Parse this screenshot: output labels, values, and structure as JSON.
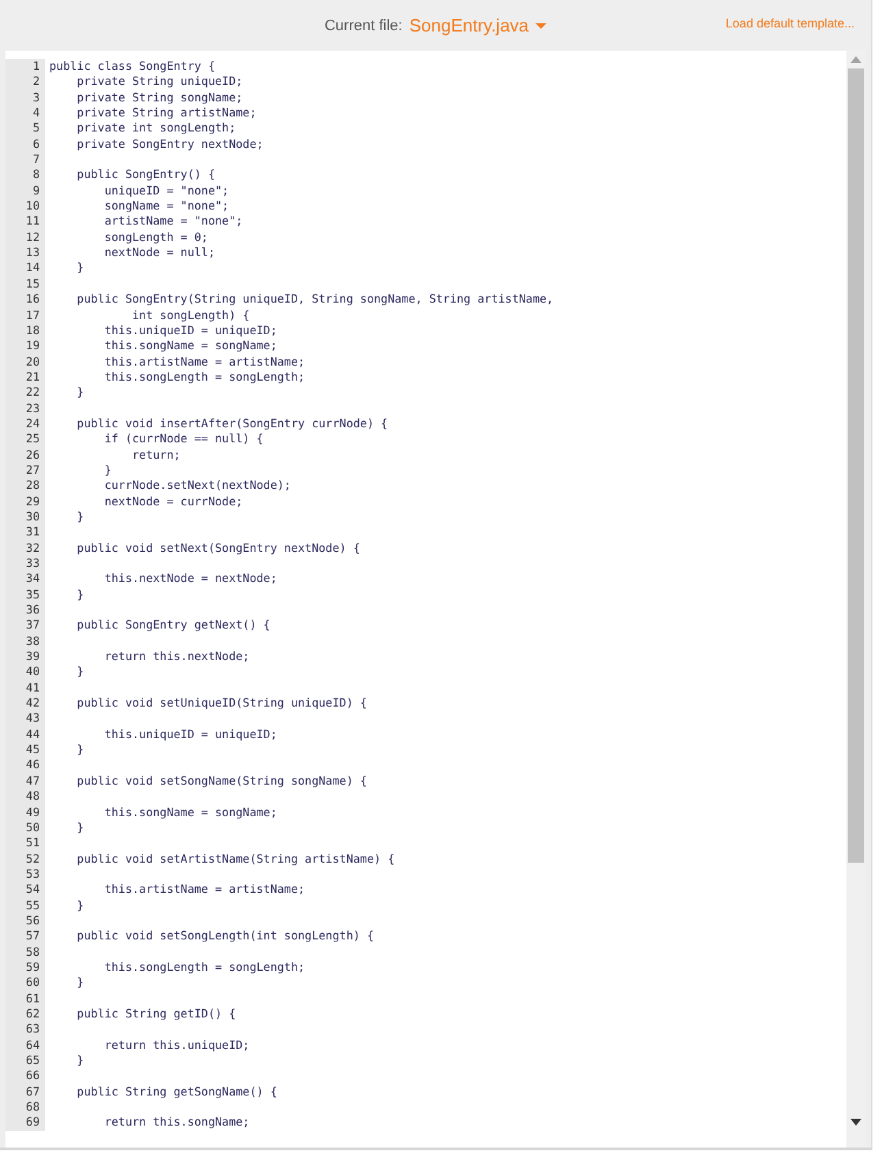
{
  "header": {
    "label": "Current file:",
    "file": "SongEntry.java",
    "action": "Load default template..."
  },
  "editor": {
    "lines": [
      {
        "n": "1",
        "code": "public class SongEntry {"
      },
      {
        "n": "2",
        "code": "    private String uniqueID;"
      },
      {
        "n": "3",
        "code": "    private String songName;"
      },
      {
        "n": "4",
        "code": "    private String artistName;"
      },
      {
        "n": "5",
        "code": "    private int songLength;"
      },
      {
        "n": "6",
        "code": "    private SongEntry nextNode;"
      },
      {
        "n": "7"
      },
      {
        "n": "8",
        "code": "    public SongEntry() {"
      },
      {
        "n": "9",
        "code": "        uniqueID = \"none\";"
      },
      {
        "n": "10",
        "code": "        songName = \"none\";"
      },
      {
        "n": "11",
        "code": "        artistName = \"none\";"
      },
      {
        "n": "12",
        "code": "        songLength = 0;"
      },
      {
        "n": "13",
        "code": "        nextNode = null;"
      },
      {
        "n": "14",
        "code": "    }"
      },
      {
        "n": "15"
      },
      {
        "n": "16",
        "code": "    public SongEntry(String uniqueID, String songName, String artistName,"
      },
      {
        "n": "17",
        "code": "            int songLength) {"
      },
      {
        "n": "18",
        "code": "        this.uniqueID = uniqueID;"
      },
      {
        "n": "19",
        "code": "        this.songName = songName;"
      },
      {
        "n": "20",
        "code": "        this.artistName = artistName;"
      },
      {
        "n": "21",
        "code": "        this.songLength = songLength;"
      },
      {
        "n": "22",
        "code": "    }"
      },
      {
        "n": "23"
      },
      {
        "n": "24",
        "code": "    public void insertAfter(SongEntry currNode) {"
      },
      {
        "n": "25",
        "code": "        if (currNode == null) {"
      },
      {
        "n": "26",
        "code": "            return;"
      },
      {
        "n": "27",
        "code": "        }"
      },
      {
        "n": "28",
        "code": "        currNode.setNext(nextNode);"
      },
      {
        "n": "29",
        "code": "        nextNode = currNode;"
      },
      {
        "n": "30",
        "code": "    }"
      },
      {
        "n": "31"
      },
      {
        "n": "32",
        "code": "    public void setNext(SongEntry nextNode) {"
      },
      {
        "n": "33"
      },
      {
        "n": "34",
        "code": "        this.nextNode = nextNode;"
      },
      {
        "n": "35",
        "code": "    }"
      },
      {
        "n": "36"
      },
      {
        "n": "37",
        "code": "    public SongEntry getNext() {"
      },
      {
        "n": "38"
      },
      {
        "n": "39",
        "code": "        return this.nextNode;"
      },
      {
        "n": "40",
        "code": "    }"
      },
      {
        "n": "41"
      },
      {
        "n": "42",
        "code": "    public void setUniqueID(String uniqueID) {"
      },
      {
        "n": "43"
      },
      {
        "n": "44",
        "code": "        this.uniqueID = uniqueID;"
      },
      {
        "n": "45",
        "code": "    }"
      },
      {
        "n": "46"
      },
      {
        "n": "47",
        "code": "    public void setSongName(String songName) {"
      },
      {
        "n": "48"
      },
      {
        "n": "49",
        "code": "        this.songName = songName;"
      },
      {
        "n": "50",
        "code": "    }"
      },
      {
        "n": "51"
      },
      {
        "n": "52",
        "code": "    public void setArtistName(String artistName) {"
      },
      {
        "n": "53"
      },
      {
        "n": "54",
        "code": "        this.artistName = artistName;"
      },
      {
        "n": "55",
        "code": "    }"
      },
      {
        "n": "56"
      },
      {
        "n": "57",
        "code": "    public void setSongLength(int songLength) {"
      },
      {
        "n": "58"
      },
      {
        "n": "59",
        "code": "        this.songLength = songLength;"
      },
      {
        "n": "60",
        "code": "    }"
      },
      {
        "n": "61"
      },
      {
        "n": "62",
        "code": "    public String getID() {"
      },
      {
        "n": "63"
      },
      {
        "n": "64",
        "code": "        return this.uniqueID;"
      },
      {
        "n": "65",
        "code": "    }"
      },
      {
        "n": "66"
      },
      {
        "n": "67",
        "code": "    public String getSongName() {"
      },
      {
        "n": "68"
      },
      {
        "n": "69",
        "code": "        return this.songName;"
      }
    ]
  }
}
